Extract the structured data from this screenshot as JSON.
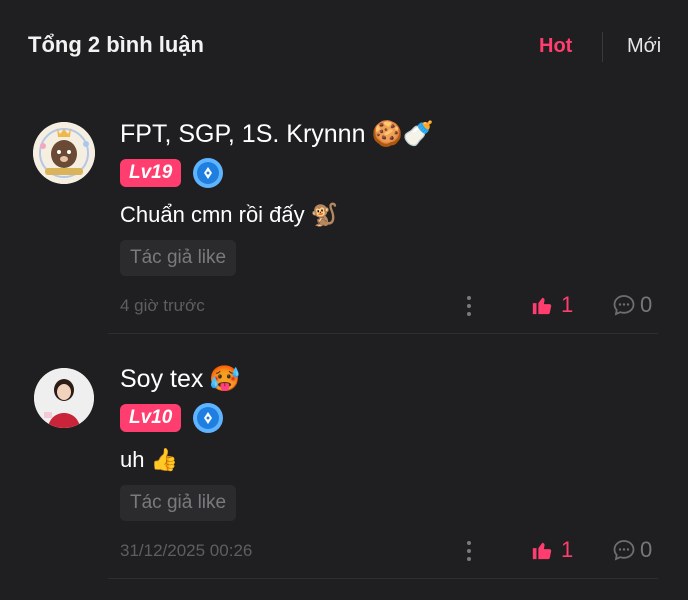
{
  "header": {
    "total": "Tổng 2 bình luận",
    "tab_hot": "Hot",
    "tab_new": "Mới"
  },
  "comments": [
    {
      "name": "FPT, SGP, 1S. Krynnn",
      "name_emoji": "🍪🍼",
      "level": "Lv19",
      "text": "Chuẩn cmn rồi đấy",
      "text_emoji": "🐒",
      "author_like": "Tác giả like",
      "time": "4 giờ trước",
      "likes": "1",
      "replies": "0"
    },
    {
      "name": "Soy tex",
      "name_emoji": "🥵",
      "level": "Lv10",
      "text": "uh",
      "text_emoji": "👍",
      "author_like": "Tác giả like",
      "time": "31/12/2025 00:26",
      "likes": "1",
      "replies": "0"
    }
  ],
  "colors": {
    "background": "#1f1f21",
    "accent": "#ff3d6e",
    "muted": "#5e5e62"
  }
}
